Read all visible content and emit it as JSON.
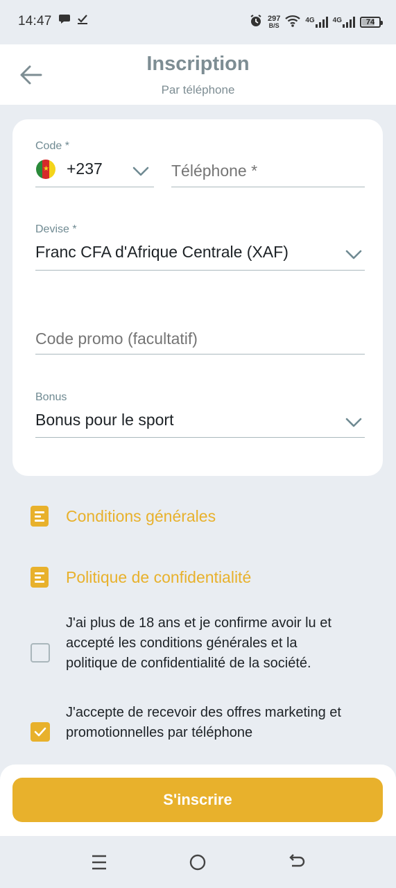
{
  "status_bar": {
    "time": "14:47",
    "speed_value": "297",
    "speed_unit": "B/S",
    "network_1": "4G",
    "network_2": "4G",
    "battery_percent": "74",
    "battery_level": 0.74
  },
  "header": {
    "title": "Inscription",
    "subtitle": "Par téléphone"
  },
  "form": {
    "code_label": "Code *",
    "code_value": "+237",
    "phone_placeholder": "Téléphone *",
    "currency_label": "Devise *",
    "currency_value": "Franc CFA d'Afrique Centrale (XAF)",
    "promo_placeholder": "Code promo (facultatif)",
    "bonus_label": "Bonus",
    "bonus_value": "Bonus pour le sport"
  },
  "links": {
    "terms": "Conditions générales",
    "privacy": "Politique de confidentialité"
  },
  "consents": {
    "age_text": "J'ai plus de 18 ans et je confirme avoir lu et accepté les conditions générales et la politique de confidentialité de la société.",
    "age_checked": false,
    "marketing_text": "J'accepte de recevoir des offres marketing et promotionnelles par téléphone",
    "marketing_checked": true
  },
  "actions": {
    "submit_label": "S'inscrire"
  },
  "colors": {
    "accent": "#e8b12c",
    "muted_text": "#7d8d93",
    "background": "#e9edf2"
  }
}
